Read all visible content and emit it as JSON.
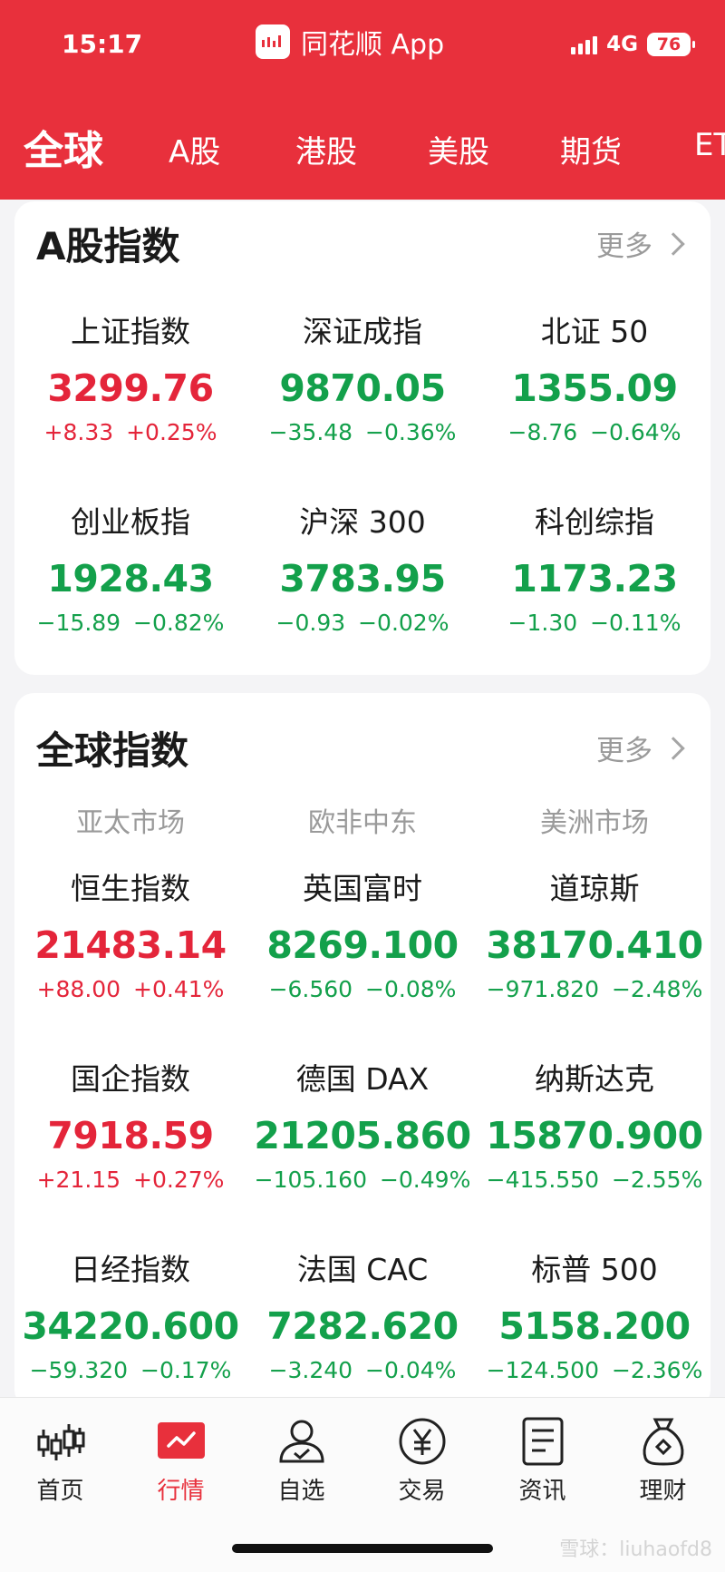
{
  "status_bar": {
    "time": "15:17",
    "app_name": "同花顺 App",
    "network": "4G",
    "battery": "76"
  },
  "tabs": [
    "全球",
    "A股",
    "港股",
    "美股",
    "期货",
    "ET"
  ],
  "a_shares": {
    "title": "A股指数",
    "more": "更多",
    "items": [
      {
        "name": "上证指数",
        "value": "3299.76",
        "change": "+8.33",
        "pct": "+0.25%",
        "dir": "up"
      },
      {
        "name": "深证成指",
        "value": "9870.05",
        "change": "−35.48",
        "pct": "−0.36%",
        "dir": "down"
      },
      {
        "name": "北证 50",
        "value": "1355.09",
        "change": "−8.76",
        "pct": "−0.64%",
        "dir": "down"
      },
      {
        "name": "创业板指",
        "value": "1928.43",
        "change": "−15.89",
        "pct": "−0.82%",
        "dir": "down"
      },
      {
        "name": "沪深 300",
        "value": "3783.95",
        "change": "−0.93",
        "pct": "−0.02%",
        "dir": "down"
      },
      {
        "name": "科创综指",
        "value": "1173.23",
        "change": "−1.30",
        "pct": "−0.11%",
        "dir": "down"
      }
    ]
  },
  "global": {
    "title": "全球指数",
    "more": "更多",
    "regions": [
      "亚太市场",
      "欧非中东",
      "美洲市场"
    ],
    "items": [
      {
        "name": "恒生指数",
        "value": "21483.14",
        "change": "+88.00",
        "pct": "+0.41%",
        "dir": "up"
      },
      {
        "name": "英国富时",
        "value": "8269.100",
        "change": "−6.560",
        "pct": "−0.08%",
        "dir": "down"
      },
      {
        "name": "道琼斯",
        "value": "38170.410",
        "change": "−971.820",
        "pct": "−2.48%",
        "dir": "down"
      },
      {
        "name": "国企指数",
        "value": "7918.59",
        "change": "+21.15",
        "pct": "+0.27%",
        "dir": "up"
      },
      {
        "name": "德国 DAX",
        "value": "21205.860",
        "change": "−105.160",
        "pct": "−0.49%",
        "dir": "down"
      },
      {
        "name": "纳斯达克",
        "value": "15870.900",
        "change": "−415.550",
        "pct": "−2.55%",
        "dir": "down"
      },
      {
        "name": "日经指数",
        "value": "34220.600",
        "change": "−59.320",
        "pct": "−0.17%",
        "dir": "down"
      },
      {
        "name": "法国 CAC",
        "value": "7282.620",
        "change": "−3.240",
        "pct": "−0.04%",
        "dir": "down"
      },
      {
        "name": "标普 500",
        "value": "5158.200",
        "change": "−124.500",
        "pct": "−2.36%",
        "dir": "down"
      }
    ]
  },
  "bottom_nav": [
    {
      "label": "首页",
      "icon": "candlestick-icon"
    },
    {
      "label": "行情",
      "icon": "market-chart-icon",
      "active": true
    },
    {
      "label": "自选",
      "icon": "user-check-icon"
    },
    {
      "label": "交易",
      "icon": "yen-circle-icon"
    },
    {
      "label": "资讯",
      "icon": "document-icon"
    },
    {
      "label": "理财",
      "icon": "money-bag-icon"
    }
  ],
  "watermark": "雪球：liuhaofd8",
  "colors": {
    "brand": "#e8303c",
    "up": "#e4253a",
    "down": "#13a04b"
  }
}
